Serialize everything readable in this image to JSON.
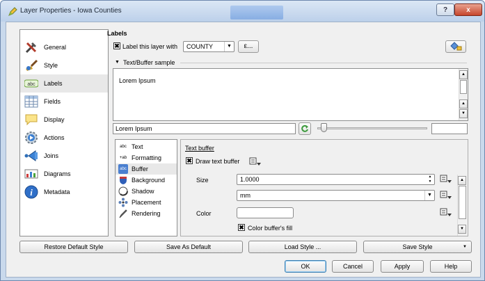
{
  "window": {
    "title": "Layer Properties - Iowa Counties",
    "help_label": "?",
    "close_label": "x"
  },
  "sidebar": {
    "items": [
      {
        "label": "General",
        "icon": "tools-icon"
      },
      {
        "label": "Style",
        "icon": "paintbrush-icon"
      },
      {
        "label": "Labels",
        "icon": "abc-label-icon",
        "selected": true
      },
      {
        "label": "Fields",
        "icon": "table-icon"
      },
      {
        "label": "Display",
        "icon": "speech-bubble-icon"
      },
      {
        "label": "Actions",
        "icon": "gear-icon"
      },
      {
        "label": "Joins",
        "icon": "join-icon"
      },
      {
        "label": "Diagrams",
        "icon": "chart-icon"
      },
      {
        "label": "Metadata",
        "icon": "info-icon"
      }
    ]
  },
  "labels": {
    "heading": "Labels",
    "label_with_text": "Label this layer with",
    "label_checked": true,
    "field_value": "COUNTY",
    "expression_label": "ε...",
    "sample_section": "Text/Buffer sample",
    "sample_text": "Lorem Ipsum",
    "sample_input": "Lorem Ipsum"
  },
  "tabs": [
    {
      "label": "Text",
      "icon": "abc"
    },
    {
      "label": "Formatting",
      "icon": "+ab"
    },
    {
      "label": "Buffer",
      "icon": "abc",
      "selected": true
    },
    {
      "label": "Background",
      "icon": "shield"
    },
    {
      "label": "Shadow",
      "icon": "shadow"
    },
    {
      "label": "Placement",
      "icon": "placement"
    },
    {
      "label": "Rendering",
      "icon": "pen"
    }
  ],
  "buffer": {
    "title": "Text buffer",
    "draw_label": "Draw text buffer",
    "draw_checked": true,
    "size_label": "Size",
    "size_value": "1.0000",
    "unit_value": "mm",
    "color_label": "Color",
    "color_fill_label": "Color buffer's fill",
    "color_fill_checked": true
  },
  "style_buttons": {
    "restore": "Restore Default Style",
    "save_default": "Save As Default",
    "load": "Load Style ...",
    "save": "Save Style"
  },
  "dialog_buttons": {
    "ok": "OK",
    "cancel": "Cancel",
    "apply": "Apply",
    "help": "Help"
  },
  "check_mark": "✖"
}
